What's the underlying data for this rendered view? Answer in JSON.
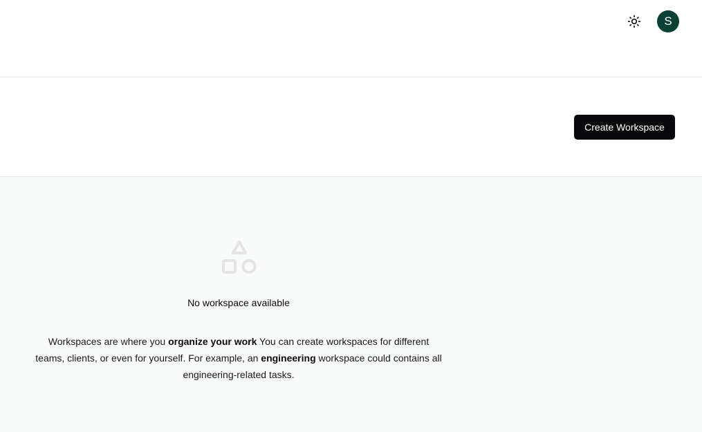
{
  "topbar": {
    "theme_toggle_icon": "sun-icon",
    "avatar_initial": "S",
    "avatar_color": "#0b4034"
  },
  "header": {
    "create_button_label": "Create Workspace",
    "create_button_color": "#09090b"
  },
  "empty_state": {
    "icon": "shapes-icon",
    "title": "No workspace available",
    "description": {
      "part1": "Workspaces are where you ",
      "bold1": "organize your work",
      "part2": " You can create workspaces for different teams, clients, or even for yourself. For example, an ",
      "bold2": "engineering",
      "part3": " workspace could contains all engineering-related tasks."
    }
  }
}
